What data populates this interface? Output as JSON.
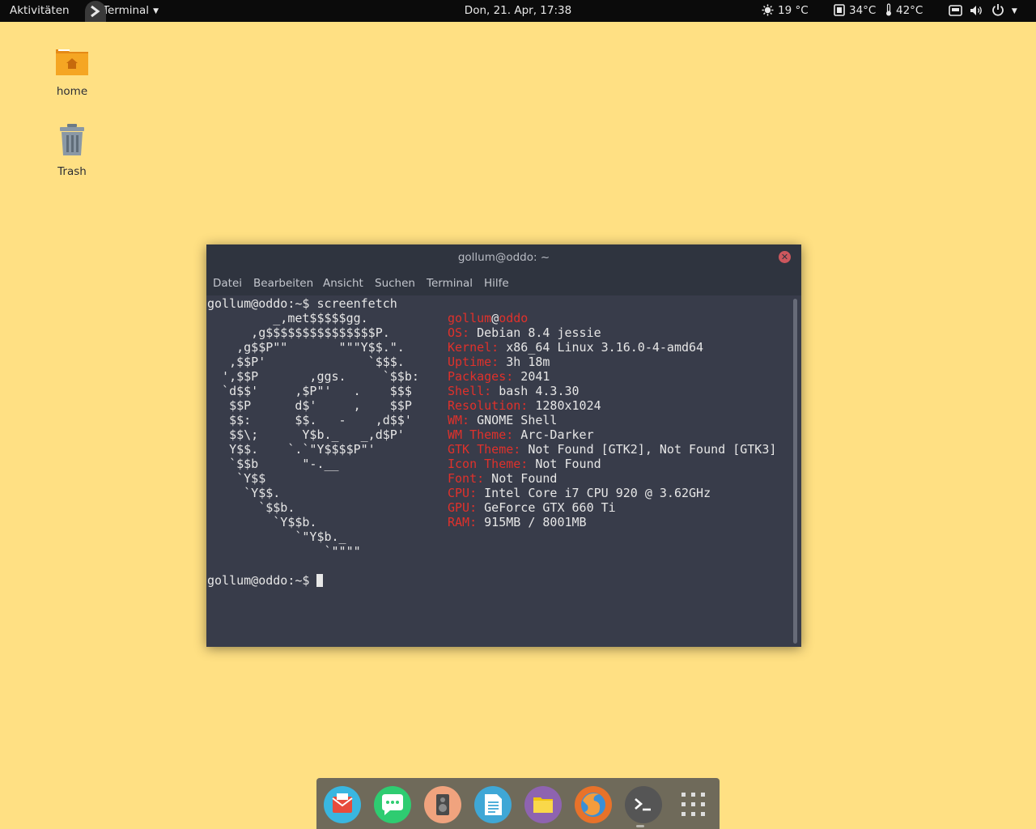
{
  "topbar": {
    "activities": "Aktivitäten",
    "app_menu": "Terminal",
    "clock": "Don, 21. Apr, 17:38",
    "weather": "19 °C",
    "cpu_temp": "34°C",
    "gpu_temp": "42°C"
  },
  "desktop": {
    "home_label": "home",
    "trash_label": "Trash"
  },
  "terminal": {
    "title": "gollum@oddo: ~",
    "menu": [
      "Datei",
      "Bearbeiten",
      "Ansicht",
      "Suchen",
      "Terminal",
      "Hilfe"
    ],
    "command_line": "gollum@oddo:~$ screenfetch",
    "prompt": "gollum@oddo:~$ ",
    "ascii_logo": [
      "         _,met$$$$$gg.",
      "      ,g$$$$$$$$$$$$$$$P.",
      "    ,g$$P\"\"       \"\"\"Y$$.\".",
      "   ,$$P'              `$$$.",
      "  ',$$P       ,ggs.     `$$b:",
      "  `d$$'     ,$P\"'   .    $$$",
      "   $$P      d$'     ,    $$P",
      "   $$:      $$.   -    ,d$$'",
      "   $$\\;      Y$b._   _,d$P'",
      "   Y$$.    `.`\"Y$$$$P\"'",
      "   `$$b      \"-.__",
      "    `Y$$",
      "     `Y$$.",
      "       `$$b.",
      "         `Y$$b.",
      "            `\"Y$b._",
      "                `\"\"\"\""
    ],
    "user": "gollum",
    "at": "@",
    "host": "oddo",
    "info": [
      {
        "key": "OS:",
        "value": " Debian 8.4 jessie"
      },
      {
        "key": "Kernel:",
        "value": " x86_64 Linux 3.16.0-4-amd64"
      },
      {
        "key": "Uptime:",
        "value": " 3h 18m"
      },
      {
        "key": "Packages:",
        "value": " 2041"
      },
      {
        "key": "Shell:",
        "value": " bash 4.3.30"
      },
      {
        "key": "Resolution:",
        "value": " 1280x1024"
      },
      {
        "key": "WM:",
        "value": " GNOME Shell"
      },
      {
        "key": "WM Theme:",
        "value": " Arc-Darker"
      },
      {
        "key": "GTK Theme:",
        "value": " Not Found [GTK2], Not Found [GTK3]"
      },
      {
        "key": "Icon Theme:",
        "value": " Not Found"
      },
      {
        "key": "Font:",
        "value": " Not Found"
      },
      {
        "key": "CPU:",
        "value": " Intel Core i7 CPU 920 @ 3.62GHz"
      },
      {
        "key": "GPU:",
        "value": " GeForce GTX 660 Ti"
      },
      {
        "key": "RAM:",
        "value": " 915MB / 8001MB"
      }
    ]
  },
  "dock": {
    "apps": [
      "mail-icon",
      "chat-icon",
      "music-player-icon",
      "text-editor-icon",
      "files-icon",
      "web-browser-icon",
      "terminal-icon",
      "show-apps-icon"
    ]
  },
  "colors": {
    "desktop": "#ffe083",
    "terminal_bg": "#383c4a",
    "accent_red": "#e0312b"
  }
}
